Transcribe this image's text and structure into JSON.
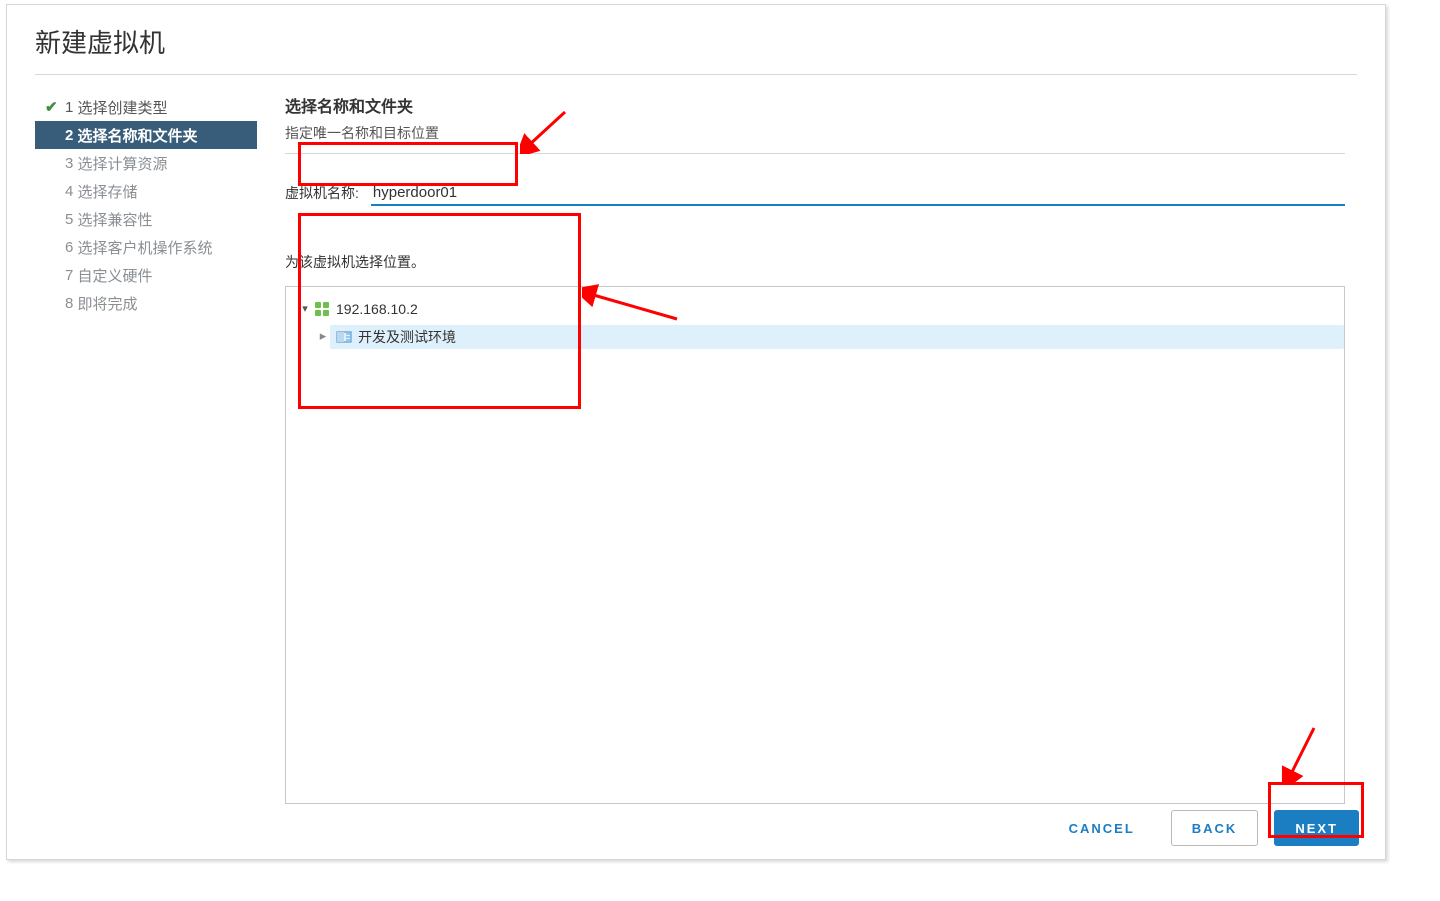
{
  "window": {
    "title": "新建虚拟机"
  },
  "steps": [
    {
      "num": "1",
      "label": "选择创建类型",
      "state": "completed"
    },
    {
      "num": "2",
      "label": "选择名称和文件夹",
      "state": "active"
    },
    {
      "num": "3",
      "label": "选择计算资源",
      "state": "pending"
    },
    {
      "num": "4",
      "label": "选择存储",
      "state": "pending"
    },
    {
      "num": "5",
      "label": "选择兼容性",
      "state": "pending"
    },
    {
      "num": "6",
      "label": "选择客户机操作系统",
      "state": "pending"
    },
    {
      "num": "7",
      "label": "自定义硬件",
      "state": "pending"
    },
    {
      "num": "8",
      "label": "即将完成",
      "state": "pending"
    }
  ],
  "pane": {
    "title": "选择名称和文件夹",
    "subtitle": "指定唯一名称和目标位置"
  },
  "vm_name": {
    "label": "虚拟机名称:",
    "value": "hyperdoor01"
  },
  "location": {
    "label": "为该虚拟机选择位置。",
    "tree": {
      "root": {
        "label": "192.168.10.2",
        "icon": "vcenter"
      },
      "child": {
        "label": "开发及测试环境",
        "icon": "datacenter",
        "selected": true
      }
    }
  },
  "footer": {
    "cancel": "CANCEL",
    "back": "BACK",
    "next": "NEXT"
  },
  "colors": {
    "accent": "#1b7ec2",
    "sidebar_active": "#385d7a",
    "annotation": "#ff0000"
  }
}
